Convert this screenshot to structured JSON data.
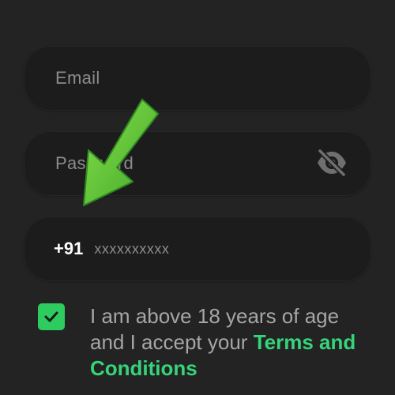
{
  "form": {
    "email_placeholder": "Email",
    "password_placeholder": "Password",
    "country_code": "+91",
    "phone_placeholder": "xxxxxxxxxx",
    "consent_text": "I am above 18 years of age and I accept your ",
    "terms_link": "Terms and Conditions",
    "checkbox_checked": true
  },
  "icons": {
    "password_toggle": "eye-slash-icon",
    "checkbox": "checkmark-icon",
    "annotation": "arrow-icon"
  },
  "colors": {
    "background": "#232323",
    "field": "#1c1c1c",
    "accent": "#2ecc5e",
    "link": "#36d47a"
  }
}
